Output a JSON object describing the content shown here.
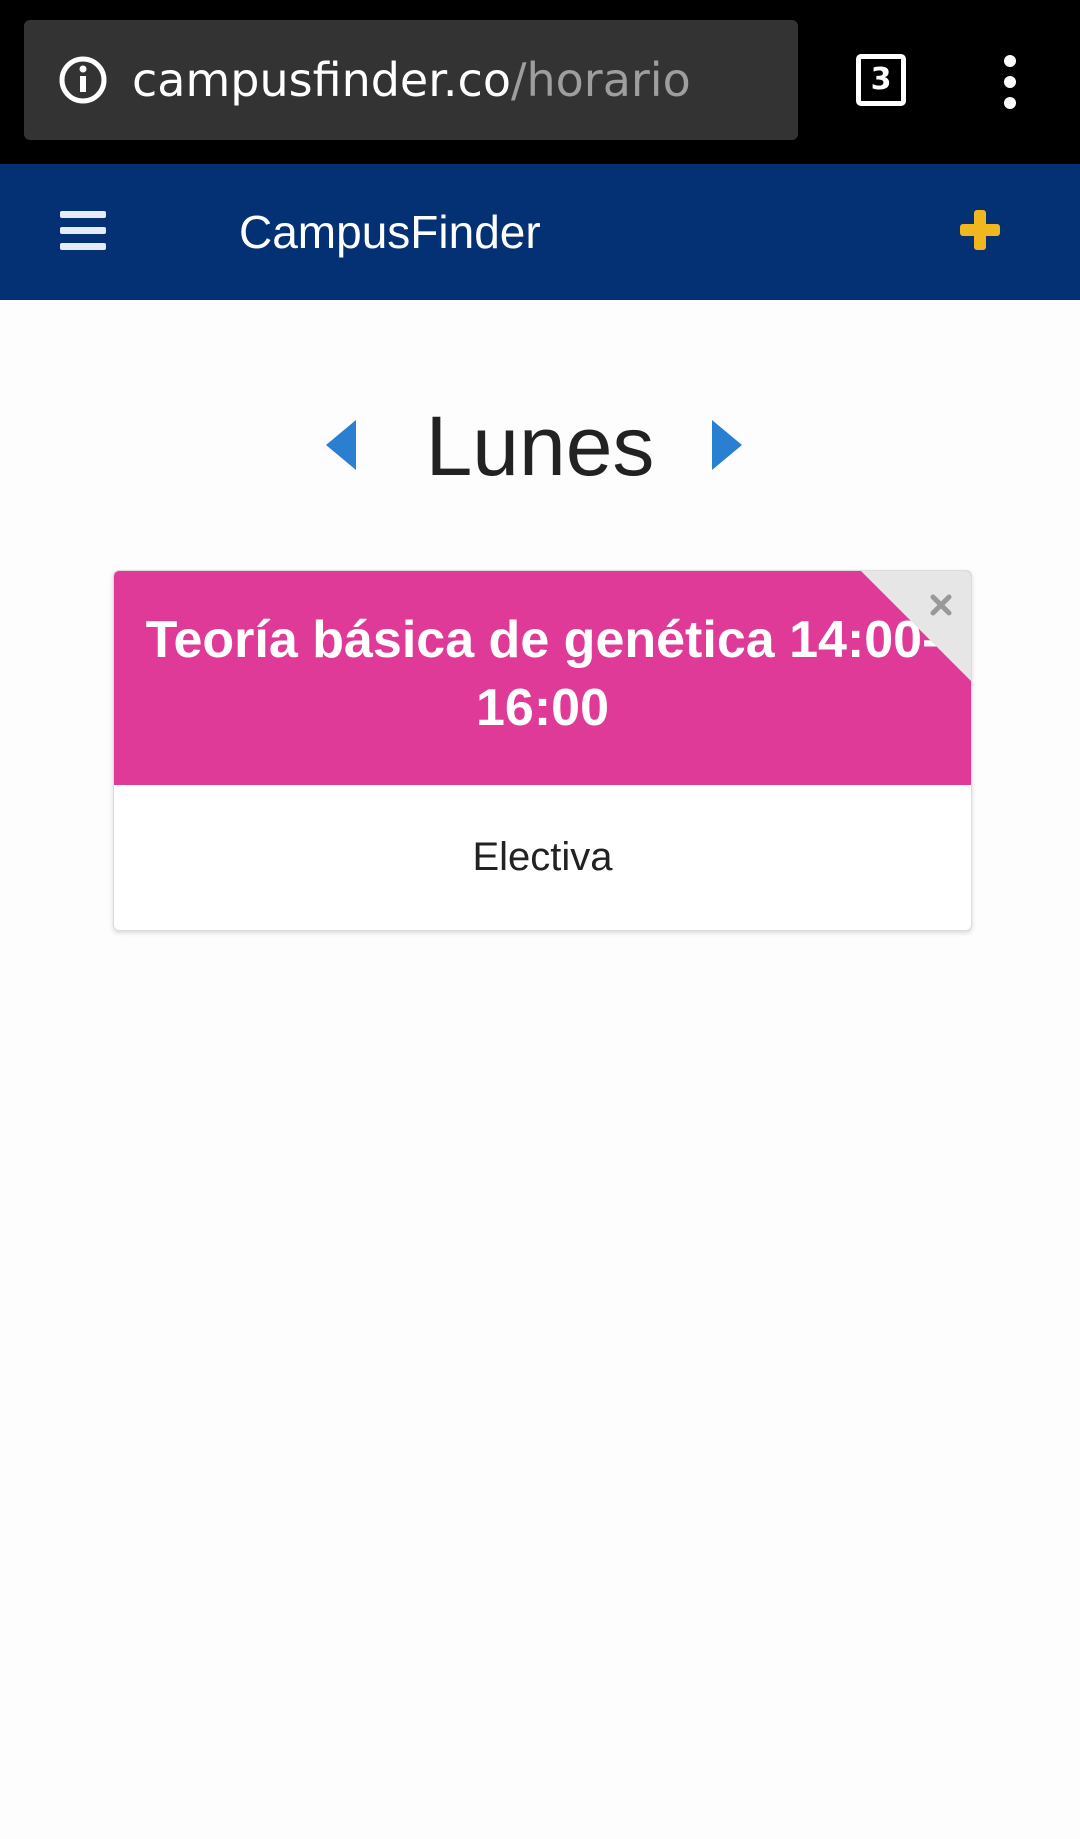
{
  "browser": {
    "url_domain": "campusfinder.co",
    "url_path": "/horario",
    "tab_count": "3",
    "icons": {
      "info": "info-icon",
      "tabs": "tab-switcher-icon",
      "menu": "more-vert-icon"
    }
  },
  "header": {
    "brand": "CampusFinder",
    "icons": {
      "menu": "hamburger-icon",
      "add": "plus-icon"
    },
    "colors": {
      "background": "#033174",
      "accent": "#f0b81e"
    }
  },
  "day_nav": {
    "day": "Lunes",
    "icons": {
      "prev": "caret-left-icon",
      "next": "caret-right-icon"
    },
    "arrow_color": "#2a7fd0"
  },
  "schedule": [
    {
      "title": "Teoría básica de genética 14:00-16:00",
      "type": "Electiva",
      "color": "#e03a98",
      "close_icon": "close-icon"
    }
  ]
}
